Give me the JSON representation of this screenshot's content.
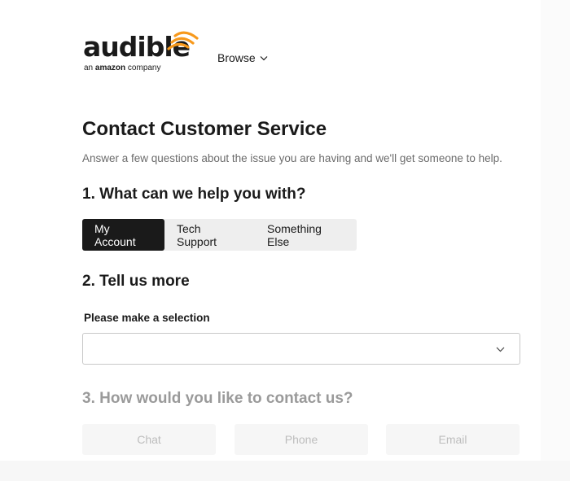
{
  "header": {
    "logo_word": "audible",
    "logo_tag_prefix": "an",
    "logo_tag_brand": "amazon",
    "logo_tag_suffix": "company",
    "browse_label": "Browse"
  },
  "main": {
    "title": "Contact Customer Service",
    "subtitle": "Answer a few questions about the issue you are having and we'll get someone to help.",
    "question1": {
      "heading": "1. What can we help you with?",
      "options": [
        "My Account",
        "Tech Support",
        "Something Else"
      ],
      "selected": "My Account"
    },
    "question2": {
      "heading": "2. Tell us more",
      "select_label": "Please make a selection",
      "select_value": ""
    },
    "question3": {
      "heading": "3. How would you like to contact us?",
      "options": [
        "Chat",
        "Phone",
        "Email"
      ]
    }
  },
  "colors": {
    "accent_orange": "#f7991c",
    "active_segment": "#1a1a1a",
    "disabled_text": "#bdbdbd"
  }
}
